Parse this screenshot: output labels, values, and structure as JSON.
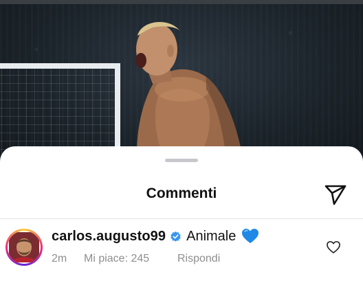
{
  "sheet": {
    "title": "Commenti"
  },
  "comment": {
    "username": "carlos.augusto99",
    "verified": true,
    "text": "Animale",
    "emoji": "blue-heart",
    "time": "2m",
    "likes": "Mi piace: 245",
    "reply": "Rispondi",
    "liked": false
  },
  "colors": {
    "verified_badge": "#3897f0",
    "emoji_heart": "#1e88e5",
    "muted_text": "#8e8e8e"
  },
  "icons": {
    "share": "paper-plane-icon",
    "like": "heart-outline-icon",
    "verified": "verified-badge-icon"
  }
}
